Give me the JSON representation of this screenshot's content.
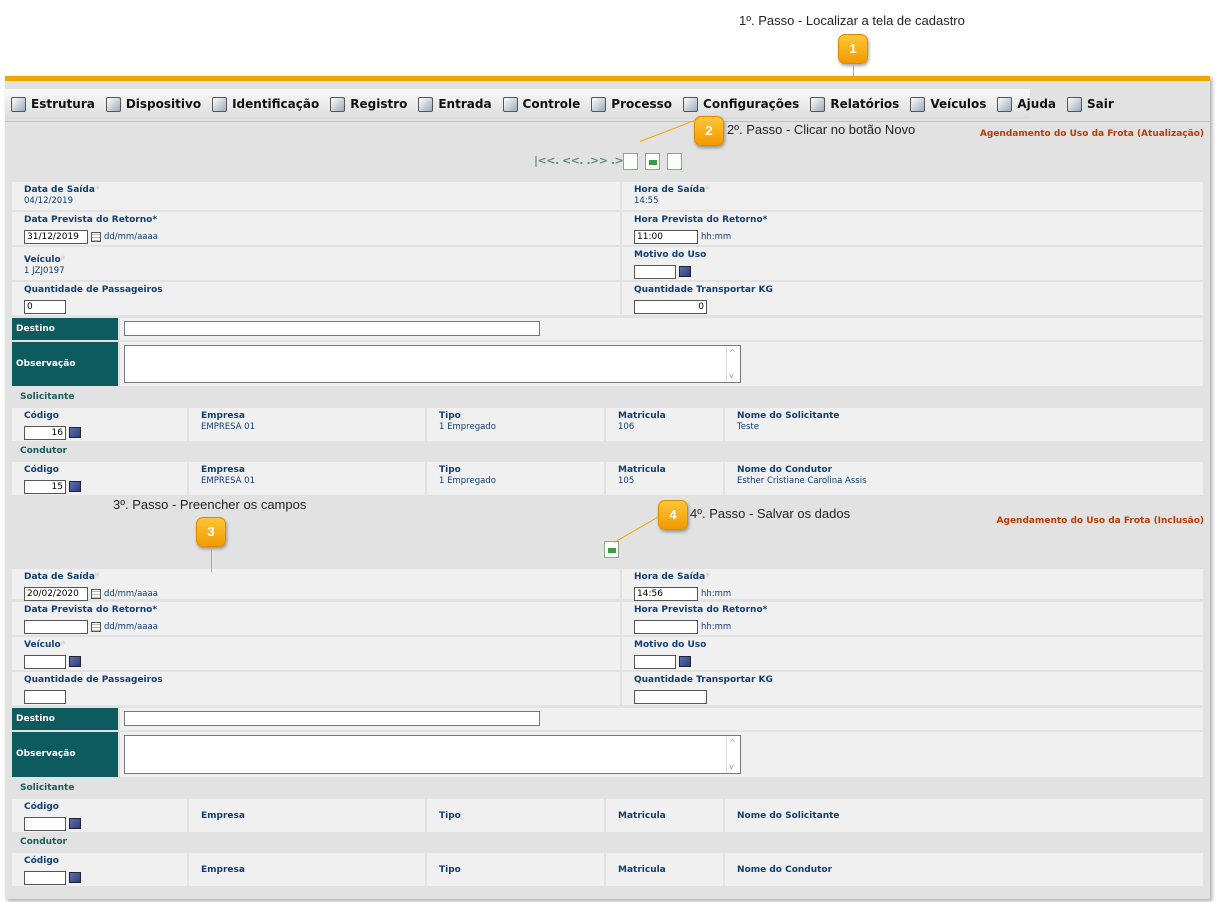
{
  "steps": {
    "s1_text": "1º. Passo - Localizar a tela de cadastro",
    "s2_text": "2º. Passo - Clicar no botão Novo",
    "s3_text": "3º. Passo - Preencher os campos",
    "s4_text": "4º. Passo - Salvar os dados",
    "b1": "1",
    "b2": "2",
    "b3": "3",
    "b4": "4"
  },
  "menu": [
    {
      "label": "Estrutura",
      "icon": "structure-icon"
    },
    {
      "label": "Dispositivo",
      "icon": "device-icon"
    },
    {
      "label": "Identificação",
      "icon": "identification-icon"
    },
    {
      "label": "Registro",
      "icon": "register-icon"
    },
    {
      "label": "Entrada",
      "icon": "entry-icon"
    },
    {
      "label": "Controle",
      "icon": "control-icon"
    },
    {
      "label": "Processo",
      "icon": "process-icon"
    },
    {
      "label": "Configurações",
      "icon": "settings-icon"
    },
    {
      "label": "Relatórios",
      "icon": "reports-icon"
    },
    {
      "label": "Veículos",
      "icon": "vehicles-icon"
    },
    {
      "label": "Ajuda",
      "icon": "help-icon"
    },
    {
      "label": "Sair",
      "icon": "exit-icon"
    }
  ],
  "update_form": {
    "title": "Agendamento do Uso da Frota (Atualização)",
    "nav": "|<<. <<. .>> .>>|",
    "data_saida_label": "Data de Saída",
    "data_saida_value": "04/12/2019",
    "hora_saida_label": "Hora de Saída",
    "hora_saida_value": "14:55",
    "data_retorno_label": "Data Prevista do Retorno",
    "data_retorno_value": "31/12/2019",
    "date_hint": "dd/mm/aaaa",
    "hora_retorno_label": "Hora Prevista do Retorno",
    "hora_retorno_value": "11:00",
    "time_hint": "hh:mm",
    "veiculo_label": "Veículo",
    "veiculo_value": "1 JZJ0197",
    "motivo_label": "Motivo do Uso",
    "passageiros_label": "Quantidade de Passageiros",
    "passageiros_value": "0",
    "kg_label": "Quantidade Transportar KG",
    "kg_value": "0",
    "destino_label": "Destino",
    "observacao_label": "Observação",
    "solicitante_title": "Solicitante",
    "solicitante": {
      "codigo_label": "Código",
      "codigo": "16",
      "empresa_label": "Empresa",
      "empresa": "EMPRESA 01",
      "tipo_label": "Tipo",
      "tipo": "1 Empregado",
      "matricula_label": "Matricula",
      "matricula": "106",
      "nome_label": "Nome do Solicitante",
      "nome": "Teste"
    },
    "condutor_title": "Condutor",
    "condutor": {
      "codigo_label": "Código",
      "codigo": "15",
      "empresa_label": "Empresa",
      "empresa": "EMPRESA 01",
      "tipo_label": "Tipo",
      "tipo": "1 Empregado",
      "matricula_label": "Matricula",
      "matricula": "105",
      "nome_label": "Nome do Condutor",
      "nome": "Esther Cristiane Carolina Assis"
    }
  },
  "insert_form": {
    "title": "Agendamento do Uso da Frota (Inclusão)",
    "data_saida_label": "Data de Saída",
    "data_saida_value": "20/02/2020",
    "hora_saida_label": "Hora de Saída",
    "hora_saida_value": "14:56",
    "date_hint": "dd/mm/aaaa",
    "time_hint": "hh:mm",
    "data_retorno_label": "Data Prevista do Retorno",
    "hora_retorno_label": "Hora Prevista do Retorno",
    "veiculo_label": "Veículo",
    "motivo_label": "Motivo do Uso",
    "passageiros_label": "Quantidade de Passageiros",
    "kg_label": "Quantidade Transportar KG",
    "destino_label": "Destino",
    "observacao_label": "Observação",
    "solicitante_title": "Solicitante",
    "solicitante": {
      "codigo_label": "Código",
      "empresa_label": "Empresa",
      "tipo_label": "Tipo",
      "matricula_label": "Matricula",
      "nome_label": "Nome do Solicitante"
    },
    "condutor_title": "Condutor",
    "condutor": {
      "codigo_label": "Código",
      "empresa_label": "Empresa",
      "tipo_label": "Tipo",
      "matricula_label": "Matricula",
      "nome_label": "Nome do Condutor"
    }
  },
  "colors": {
    "accent": "#f0a500",
    "dark_label": "#0d5b5f",
    "title_red": "#c03a00",
    "label_blue": "#123e72"
  }
}
